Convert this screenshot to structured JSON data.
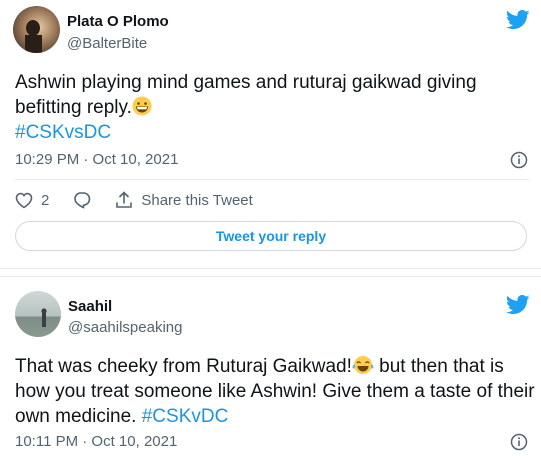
{
  "tweets": [
    {
      "name": "Plata O Plomo",
      "handle": "@BalterBite",
      "text_before": "Ashwin playing mind games  and ruturaj gaikwad giving befitting reply.",
      "emoji": "grinning-face-emoji",
      "hashtag": "#CSKvsDC",
      "timestamp": "10:29 PM · Oct 10, 2021",
      "like_count": "2",
      "share_label": "Share this Tweet",
      "reply_label": "Tweet your reply"
    },
    {
      "name": "Saahil",
      "handle": "@saahilspeaking",
      "text_before": "That was cheeky from Ruturaj Gaikwad!",
      "emoji": "tears-of-joy-emoji",
      "text_after": " but then that is how you treat someone like Ashwin! Give them a taste of their own medicine. ",
      "hashtag": "#CSKvDC",
      "timestamp": "10:11 PM · Oct 10, 2021"
    }
  ],
  "colors": {
    "accent": "#1b95e0",
    "secondary_text": "#536471",
    "border": "#e6ecf0"
  }
}
